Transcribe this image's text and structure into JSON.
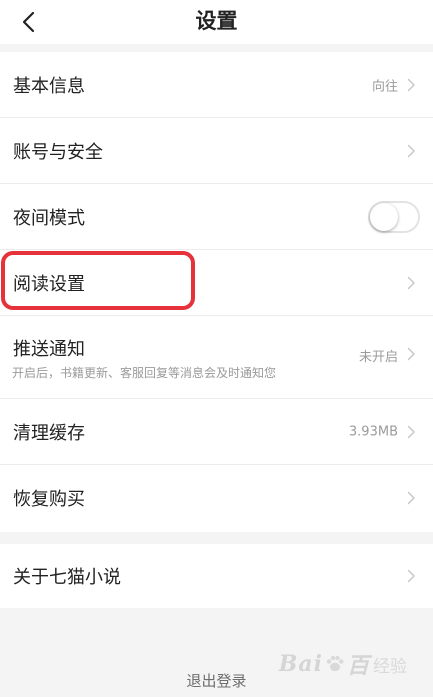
{
  "header": {
    "title": "设置",
    "back_icon": "chevron-left-icon"
  },
  "settings": [
    {
      "label": "基本信息",
      "value": "向往",
      "control": "chevron"
    },
    {
      "label": "账号与安全",
      "value": "",
      "control": "chevron"
    },
    {
      "label": "夜间模式",
      "value": "",
      "control": "toggle",
      "toggle_on": false
    },
    {
      "label": "阅读设置",
      "value": "",
      "control": "chevron",
      "highlighted": true
    },
    {
      "label": "推送通知",
      "sublabel": "开启后，书籍更新、客服回复等消息会及时通知您",
      "value": "未开启",
      "control": "chevron"
    },
    {
      "label": "清理缓存",
      "value": "3.93MB",
      "control": "chevron"
    },
    {
      "label": "恢复购买",
      "value": "",
      "control": "chevron"
    }
  ],
  "about": {
    "label": "关于七猫小说",
    "control": "chevron"
  },
  "logout_label": "退出登录",
  "watermark": {
    "brand": "Bai",
    "brand_tail": "百",
    "cn": "经验"
  },
  "colors": {
    "highlight": "#e5323b",
    "background": "#f4f4f5",
    "text": "#222222",
    "secondary": "#9b9b9b"
  }
}
